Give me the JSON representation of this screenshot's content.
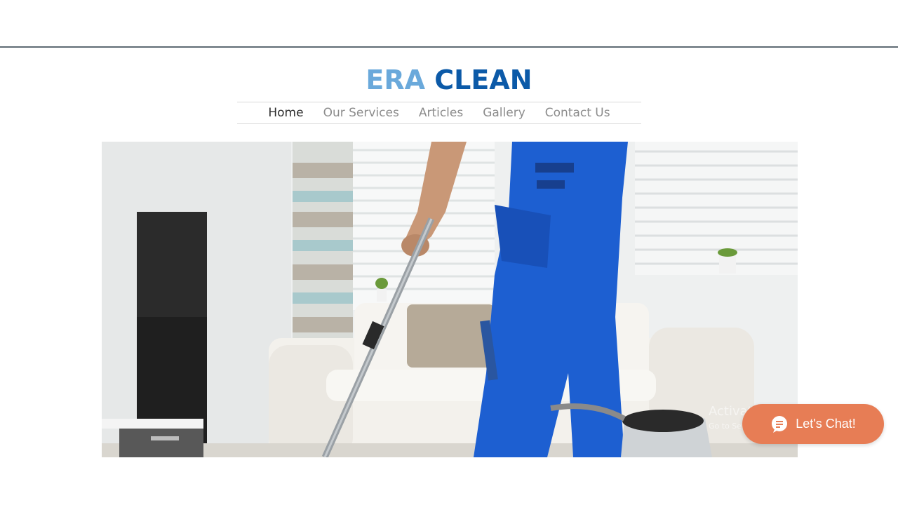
{
  "logo": {
    "word1": "ERA",
    "word2": "CLEAN",
    "color1": "#6aa9db",
    "color2": "#0c5aa8"
  },
  "nav": {
    "items": [
      {
        "label": "Home",
        "active": true
      },
      {
        "label": "Our Services",
        "active": false
      },
      {
        "label": "Articles",
        "active": false
      },
      {
        "label": "Gallery",
        "active": false
      },
      {
        "label": "Contact Us",
        "active": false
      }
    ]
  },
  "hero": {
    "image": "cleaner-vacuuming-living-room-photo"
  },
  "chat": {
    "label": "Let's Chat!",
    "icon": "chat-bubble-icon",
    "color": "#e77d55"
  },
  "watermark": {
    "line1": "Activate Windows",
    "line2": "Go to Settings to activate Windows."
  }
}
